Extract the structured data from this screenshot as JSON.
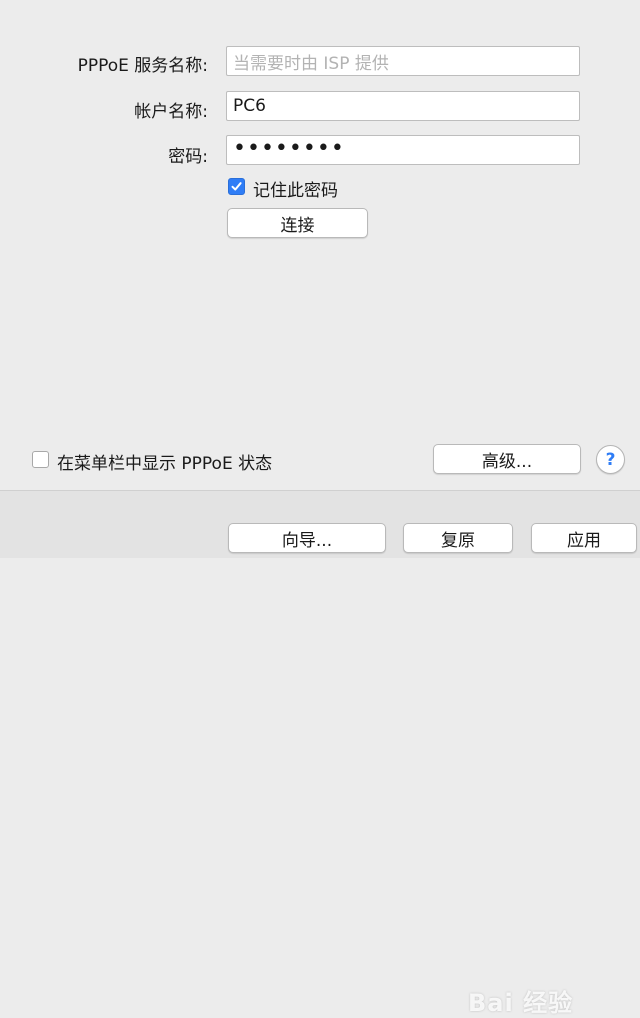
{
  "form": {
    "service_label": "PPPoE 服务名称:",
    "service_placeholder": "当需要时由 ISP 提供",
    "account_label": "帐户名称:",
    "account_value": "PC6",
    "password_label": "密码:",
    "password_value": "••••••••",
    "remember_label": "记住此密码",
    "remember_checked": true,
    "connect_label": "连接"
  },
  "bottom": {
    "show_status_label": "在菜单栏中显示 PPPoE 状态",
    "show_status_checked": false,
    "advanced_label": "高级...",
    "help_label": "?"
  },
  "footer": {
    "assistant_label": "向导...",
    "revert_label": "复原",
    "apply_label": "应用"
  },
  "watermark": {
    "text": "Bai 经验"
  },
  "colors": {
    "accent": "#2f7df6",
    "background": "#ececec"
  }
}
